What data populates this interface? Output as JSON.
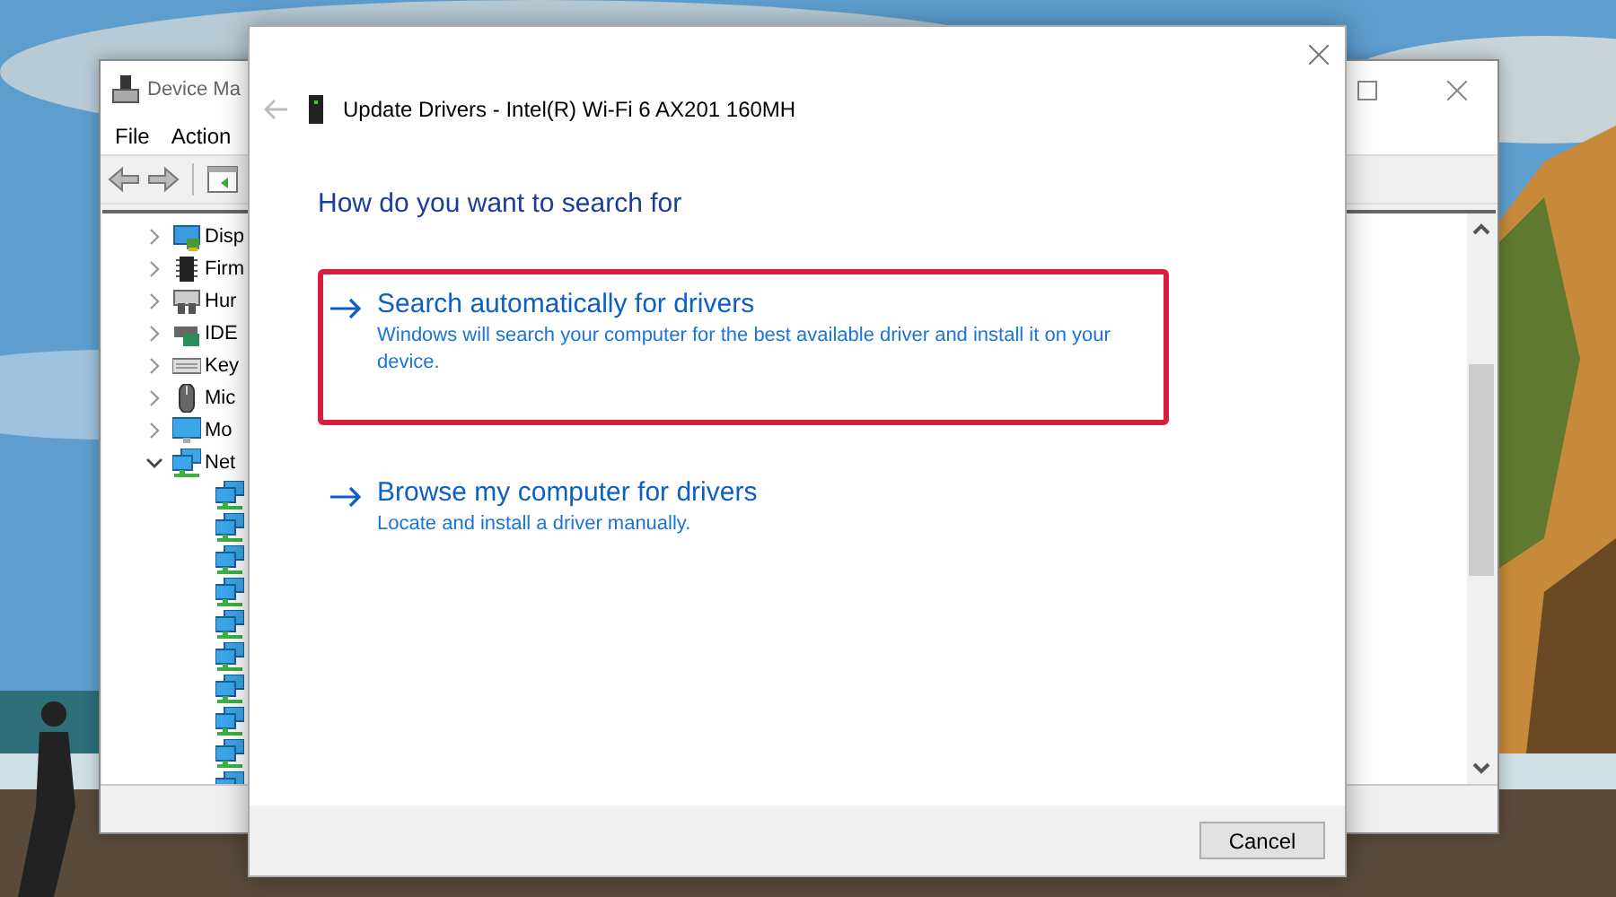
{
  "device_manager": {
    "title": "Device Ma",
    "menu": [
      "File",
      "Action"
    ],
    "tree": [
      {
        "kind": "display",
        "label": "Disp",
        "expanded": false
      },
      {
        "kind": "chip",
        "label": "Firm",
        "expanded": false
      },
      {
        "kind": "hid",
        "label": "Hur",
        "expanded": false
      },
      {
        "kind": "ide",
        "label": "IDE",
        "expanded": false
      },
      {
        "kind": "keyboard",
        "label": "Key",
        "expanded": false
      },
      {
        "kind": "mouse",
        "label": "Mic",
        "expanded": false
      },
      {
        "kind": "monitor",
        "label": "Mo",
        "expanded": false
      },
      {
        "kind": "network",
        "label": "Net",
        "expanded": true,
        "children": [
          {
            "kind": "network"
          },
          {
            "kind": "network"
          },
          {
            "kind": "network"
          },
          {
            "kind": "network"
          },
          {
            "kind": "network"
          },
          {
            "kind": "network"
          },
          {
            "kind": "network"
          },
          {
            "kind": "network"
          },
          {
            "kind": "network"
          },
          {
            "kind": "network"
          }
        ]
      }
    ]
  },
  "dialog": {
    "title": "Update Drivers - Intel(R) Wi-Fi 6 AX201 160MH",
    "heading": "How do you want to search for",
    "options": [
      {
        "title": "Search automatically for drivers",
        "description": "Windows will search your computer for the best available driver and install it on your device.",
        "selected": true
      },
      {
        "title": "Browse my computer for drivers",
        "description": "Locate and install a driver manually.",
        "selected": false
      }
    ],
    "buttons": [
      "Cancel"
    ]
  }
}
